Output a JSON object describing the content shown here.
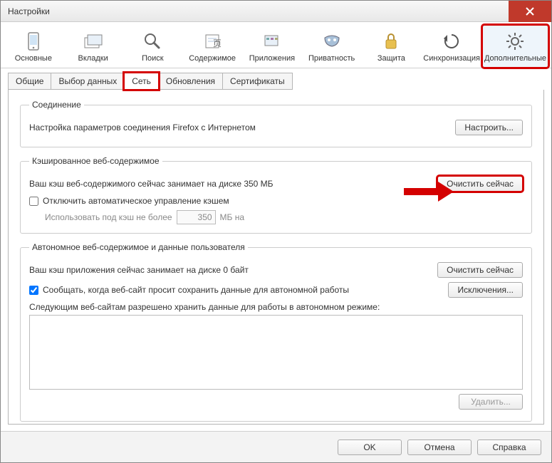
{
  "window": {
    "title": "Настройки"
  },
  "toolbar": [
    {
      "id": "general",
      "label": "Основные"
    },
    {
      "id": "tabs",
      "label": "Вкладки"
    },
    {
      "id": "search",
      "label": "Поиск"
    },
    {
      "id": "content",
      "label": "Содержимое"
    },
    {
      "id": "apps",
      "label": "Приложения"
    },
    {
      "id": "privacy",
      "label": "Приватность"
    },
    {
      "id": "security",
      "label": "Защита"
    },
    {
      "id": "sync",
      "label": "Синхронизация"
    },
    {
      "id": "advanced",
      "label": "Дополнительные"
    }
  ],
  "subtabs": {
    "general": "Общие",
    "data": "Выбор данных",
    "network": "Сеть",
    "updates": "Обновления",
    "certs": "Сертификаты"
  },
  "connection": {
    "legend": "Соединение",
    "text": "Настройка параметров соединения Firefox с Интернетом",
    "button": "Настроить..."
  },
  "cache": {
    "legend": "Кэшированное веб-содержимое",
    "text": "Ваш кэш веб-содержимого сейчас занимает на диске 350 МБ",
    "clear": "Очистить сейчас",
    "override_label": "Отключить автоматическое управление кэшем",
    "limit_prefix": "Использовать под кэш не более",
    "limit_value": "350",
    "limit_suffix": "МБ на"
  },
  "offline": {
    "legend": "Автономное веб-содержимое и данные пользователя",
    "text": "Ваш кэш приложения сейчас занимает на диске 0 байт",
    "clear": "Очистить сейчас",
    "notify_label": "Сообщать, когда веб-сайт просит сохранить данные для автономной работы",
    "exceptions": "Исключения...",
    "list_label": "Следующим веб-сайтам разрешено хранить данные для работы в автономном режиме:",
    "remove": "Удалить..."
  },
  "buttons": {
    "ok": "OK",
    "cancel": "Отмена",
    "help": "Справка"
  }
}
